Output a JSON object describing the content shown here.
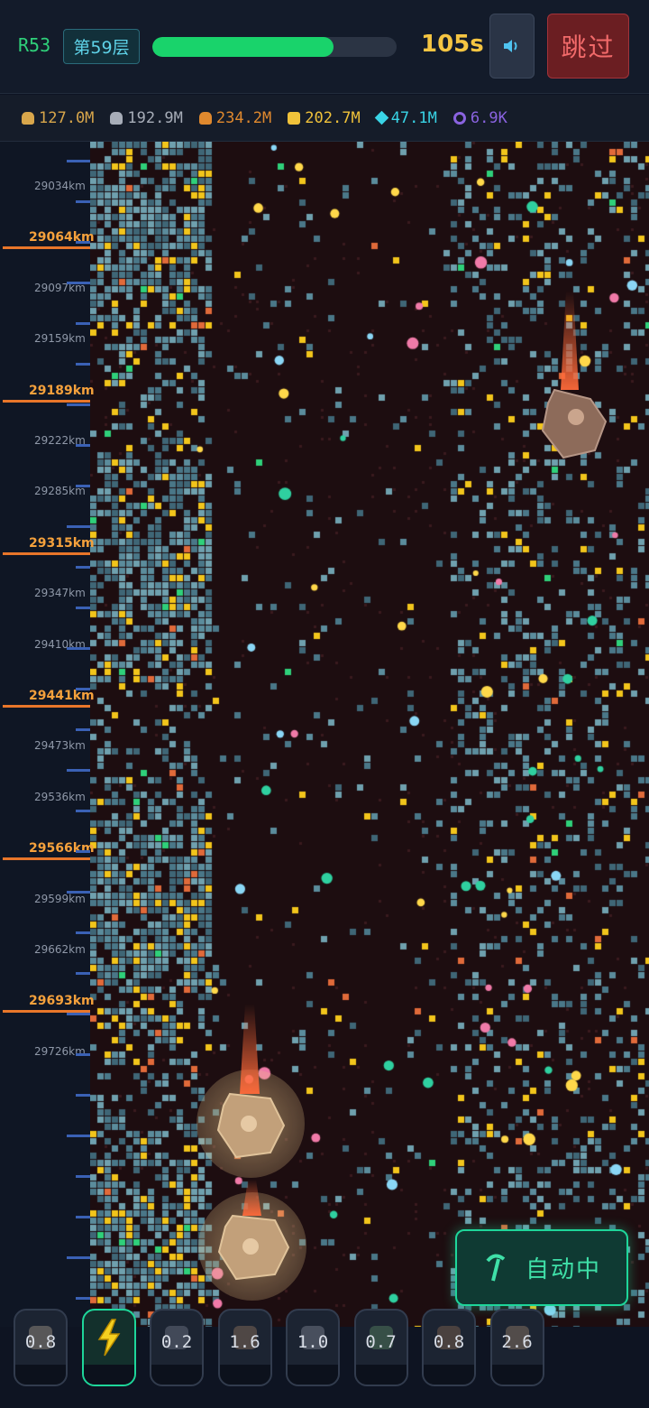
{
  "header": {
    "round": "R53",
    "layer": "第59层",
    "progress": 0.74,
    "timer": "105s",
    "sound_icon": "speaker-icon",
    "skip_label": "跳过"
  },
  "resources": [
    {
      "icon": "gold-ore-icon",
      "color": "#d8a64b",
      "value": "127.0M"
    },
    {
      "icon": "stone-icon",
      "color": "#a7adb8",
      "value": "192.9M"
    },
    {
      "icon": "copper-icon",
      "color": "#e0892e",
      "value": "234.2M"
    },
    {
      "icon": "coin-icon",
      "color": "#f0c23a",
      "value": "202.7M"
    },
    {
      "icon": "diamond-icon",
      "color": "#39d4e6",
      "value": "47.1M"
    },
    {
      "icon": "amethyst-icon",
      "color": "#8a63e0",
      "value": "6.9K"
    }
  ],
  "depth_labels": [
    {
      "text": "29034km",
      "major": false
    },
    {
      "text": "29064km",
      "major": true
    },
    {
      "text": "29097km",
      "major": false
    },
    {
      "text": "29159km",
      "major": false
    },
    {
      "text": "29189km",
      "major": true
    },
    {
      "text": "29222km",
      "major": false
    },
    {
      "text": "29285km",
      "major": false
    },
    {
      "text": "29315km",
      "major": true
    },
    {
      "text": "29347km",
      "major": false
    },
    {
      "text": "29410km",
      "major": false
    },
    {
      "text": "29441km",
      "major": true
    },
    {
      "text": "29473km",
      "major": false
    },
    {
      "text": "29536km",
      "major": false
    },
    {
      "text": "29566km",
      "major": true
    },
    {
      "text": "29599km",
      "major": false
    },
    {
      "text": "29662km",
      "major": false
    },
    {
      "text": "29693km",
      "major": true
    },
    {
      "text": "29726km",
      "major": false
    }
  ],
  "auto_button": {
    "label": "自动中",
    "icon": "pickaxe-icon"
  },
  "tools": [
    {
      "icon": "spark-burst-icon",
      "value": "0.8",
      "active": false
    },
    {
      "icon": "lightning-icon",
      "value": "",
      "active": true
    },
    {
      "icon": "magnet-icon",
      "value": "0.2",
      "active": false
    },
    {
      "icon": "drill-icon",
      "value": "1.6",
      "active": false
    },
    {
      "icon": "vortex-icon",
      "value": "1.0",
      "active": false
    },
    {
      "icon": "potion-icon",
      "value": "0.7",
      "active": false
    },
    {
      "icon": "hammer-icon",
      "value": "0.8",
      "active": false
    },
    {
      "icon": "crystal-icon",
      "value": "2.6",
      "active": false
    }
  ],
  "colors": {
    "accent_green": "#1ed69a",
    "timer_yellow": "#f5c542",
    "depth_major": "#f5a13c",
    "skip_red": "#f26a6a"
  }
}
